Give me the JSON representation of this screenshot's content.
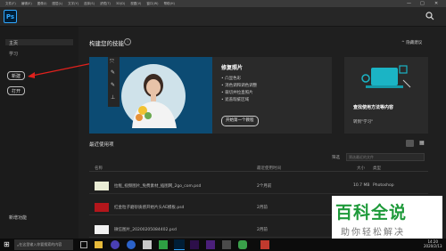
{
  "menu": [
    "文件(F)",
    "编辑(E)",
    "图像(I)",
    "图层(L)",
    "文字(Y)",
    "选择(S)",
    "滤镜(T)",
    "3D(D)",
    "视图(V)",
    "窗口(W)",
    "帮助(H)"
  ],
  "window_controls": [
    "—",
    "□",
    "✕"
  ],
  "app_logo": "Ps",
  "sidebar": {
    "home": "主页",
    "learn": "学习",
    "new_button": "新建",
    "open_button": "打开",
    "whats_new": "新增功能"
  },
  "main": {
    "title": "构建您的技能",
    "info_icon": "i",
    "hide": "隐藏建议"
  },
  "feature": {
    "title": "修复照片",
    "bullets": [
      "凸显色彩",
      "消色调和调色调整",
      "裁切并拉直照片",
      "遮盖瑕疵区域"
    ],
    "button": "开始第一个教程"
  },
  "side_card": {
    "title": "查找使用方法等内容",
    "link": "转到\"学习\""
  },
  "recent": {
    "title": "最近使用项",
    "filter": "筛选",
    "filter_placeholder": "筛选最近的文件",
    "columns": [
      "名称",
      "最近使用时间",
      "大小",
      "类型"
    ],
    "rows": [
      {
        "name": "拉框_视频图片_免费素材_插图网_2go_com.psd",
        "time": "2个月前",
        "size": "10.7 MB",
        "type": "Photoshop"
      },
      {
        "name": "红金粒子磨砂质感开始片头AE模板.psd",
        "time": "2月前",
        "size": "",
        "type": ""
      },
      {
        "name": "微信图片_20200205084402.psd",
        "time": "2月前",
        "size": "",
        "type": ""
      }
    ]
  },
  "taskbar": {
    "search_placeholder": "在这里输入你要搜索的内容",
    "clock": "14:20",
    "date": "2020/2/13"
  },
  "watermark": {
    "title": "百科全说",
    "subtitle": "助你轻松解决"
  },
  "colors": {
    "accent": "#31a8ff",
    "annotation_arrow": "#e0211d",
    "watermark_green": "#1e9a3a"
  }
}
